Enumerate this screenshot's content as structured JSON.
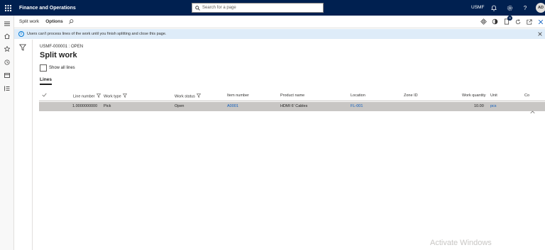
{
  "topbar": {
    "title": "Finance and Operations",
    "search_placeholder": "Search for a page",
    "company": "USMF",
    "help": "?",
    "user_initials": "AD",
    "background": "#002050"
  },
  "actionbar": {
    "tabs": [
      "Split work",
      "Options"
    ],
    "badge_count": "0"
  },
  "infobar": {
    "message": "Users can't process lines of the work until you finish splitting and close this page.",
    "background": "#deecf9"
  },
  "page": {
    "caption": "USMF-000001 : OPEN",
    "title": "Split work",
    "show_all_lines_label": "Show all lines",
    "show_all_lines_checked": false,
    "tab": "Lines"
  },
  "grid": {
    "columns": [
      "Line number",
      "Work type",
      "Work status",
      "Item number",
      "Product name",
      "Location",
      "Zone ID",
      "Work quantity",
      "Unit",
      "Co"
    ],
    "rows": [
      {
        "line_number": "1.0000000000",
        "work_type": "Pick",
        "work_status": "Open",
        "item_number": "A0001",
        "product_name": "HDMI 6' Cables",
        "location": "FL-001",
        "zone_id": "",
        "work_quantity": "10.00",
        "unit": "pcs"
      }
    ],
    "selected_row_color": "#c8c6c4"
  },
  "watermark": "Activate Windows"
}
